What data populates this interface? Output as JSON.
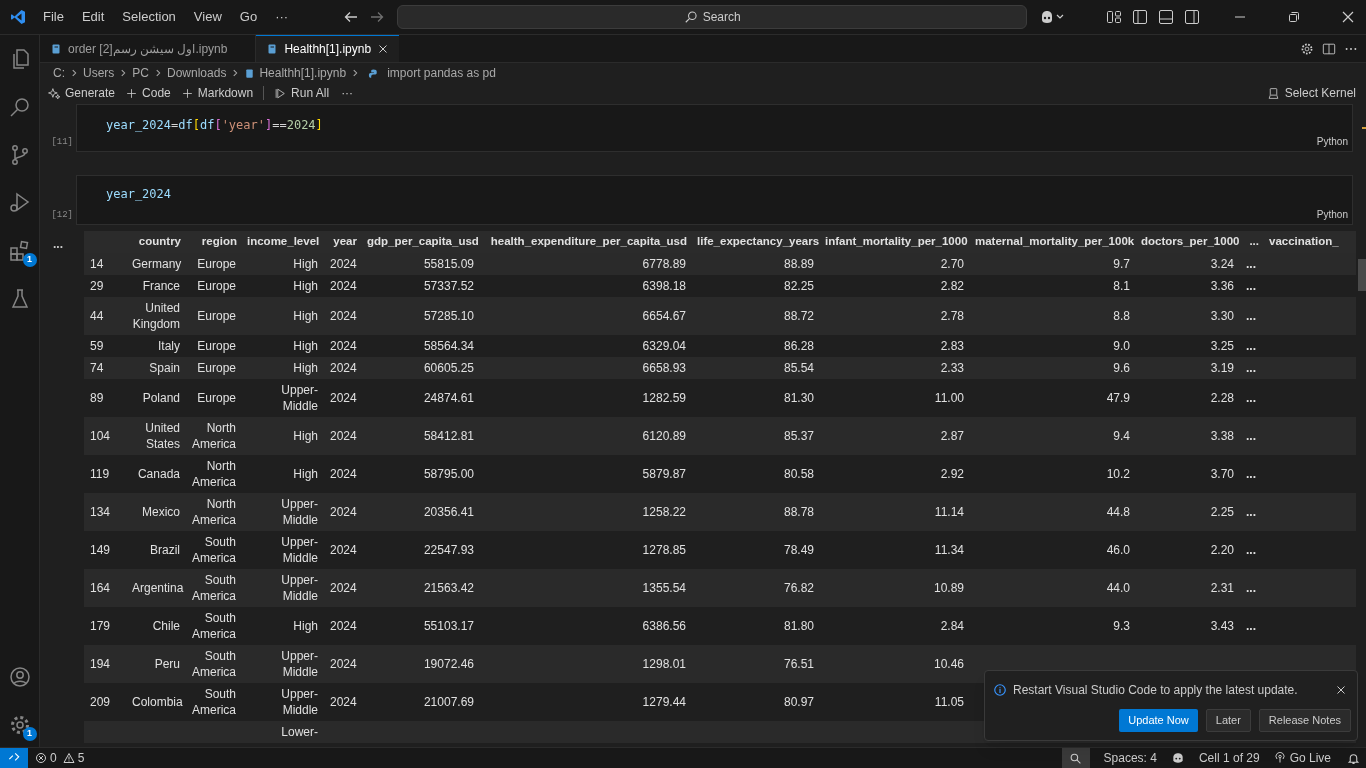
{
  "menu": [
    "File",
    "Edit",
    "Selection",
    "View",
    "Go",
    "···"
  ],
  "search": {
    "placeholder": "Search"
  },
  "activity_bar": [
    {
      "kind": "explorer"
    },
    {
      "kind": "search"
    },
    {
      "kind": "source-control"
    },
    {
      "kind": "run-debug"
    },
    {
      "kind": "extensions",
      "badge": "1"
    },
    {
      "kind": "testing"
    }
  ],
  "activity_bar_bottom": [
    {
      "kind": "accounts"
    },
    {
      "kind": "manage",
      "badge": "1"
    }
  ],
  "tabs": [
    {
      "label": "order [2]اول سيشن رسم.ipynb",
      "selected": false
    },
    {
      "label": "Healthh[1].ipynb",
      "selected": true
    }
  ],
  "breadcrumbs": [
    "C:",
    "Users",
    "PC",
    "Downloads",
    "Healthh[1].ipynb",
    "import pandas as pd"
  ],
  "toolbar": [
    {
      "kind": "generate",
      "label": "Generate"
    },
    {
      "kind": "add",
      "label": "Code"
    },
    {
      "kind": "add",
      "label": "Markdown"
    },
    {
      "kind": "run",
      "label": "Run All"
    },
    {
      "kind": "more",
      "label": "···"
    }
  ],
  "kernel": "Select Kernel",
  "cells": [
    {
      "execution_count": "[11]",
      "language": "Python",
      "code": [
        {
          "text": "year_2024",
          "kind": "variable"
        },
        {
          "text": "=",
          "kind": "operator"
        },
        {
          "text": "df",
          "kind": "variable"
        },
        {
          "text": "[",
          "kind": "bracket1"
        },
        {
          "text": "df",
          "kind": "variable"
        },
        {
          "text": "[",
          "kind": "bracket2"
        },
        {
          "text": "'year'",
          "kind": "string"
        },
        {
          "text": "]",
          "kind": "bracket2"
        },
        {
          "text": "==",
          "kind": "operator"
        },
        {
          "text": "2024",
          "kind": "number"
        },
        {
          "text": "]",
          "kind": "bracket1"
        }
      ]
    },
    {
      "execution_count": "[12]",
      "language": "Python",
      "code": [
        {
          "text": "year_2024",
          "kind": "variable"
        }
      ]
    }
  ],
  "output": {
    "more": "...",
    "table": {
      "columns": [
        "country",
        "region",
        "income_level",
        "year",
        "gdp_per_capita_usd",
        "health_expenditure_per_capita_usd",
        "life_expectancy_years",
        "infant_mortality_per_1000",
        "maternal_mortality_per_100k",
        "doctors_per_1000",
        "...",
        "vaccination_"
      ],
      "rows": [
        {
          "index": "14",
          "country": "Germany",
          "region": "Europe",
          "income_level": "High",
          "year": "2024",
          "gdp": "55815.09",
          "health": "6778.89",
          "life": "88.89",
          "infant": "2.70",
          "maternal": "9.7",
          "doctors": "3.24",
          "more": "..."
        },
        {
          "index": "29",
          "country": "France",
          "region": "Europe",
          "income_level": "High",
          "year": "2024",
          "gdp": "57337.52",
          "health": "6398.18",
          "life": "82.25",
          "infant": "2.82",
          "maternal": "8.1",
          "doctors": "3.36",
          "more": "..."
        },
        {
          "index": "44",
          "country": "United Kingdom",
          "region": "Europe",
          "income_level": "High",
          "year": "2024",
          "gdp": "57285.10",
          "health": "6654.67",
          "life": "88.72",
          "infant": "2.78",
          "maternal": "8.8",
          "doctors": "3.30",
          "more": "..."
        },
        {
          "index": "59",
          "country": "Italy",
          "region": "Europe",
          "income_level": "High",
          "year": "2024",
          "gdp": "58564.34",
          "health": "6329.04",
          "life": "86.28",
          "infant": "2.83",
          "maternal": "9.0",
          "doctors": "3.25",
          "more": "..."
        },
        {
          "index": "74",
          "country": "Spain",
          "region": "Europe",
          "income_level": "High",
          "year": "2024",
          "gdp": "60605.25",
          "health": "6658.93",
          "life": "85.54",
          "infant": "2.33",
          "maternal": "9.6",
          "doctors": "3.19",
          "more": "..."
        },
        {
          "index": "89",
          "country": "Poland",
          "region": "Europe",
          "income_level": "Upper-Middle",
          "year": "2024",
          "gdp": "24874.61",
          "health": "1282.59",
          "life": "81.30",
          "infant": "11.00",
          "maternal": "47.9",
          "doctors": "2.28",
          "more": "..."
        },
        {
          "index": "104",
          "country": "United States",
          "region": "North America",
          "income_level": "High",
          "year": "2024",
          "gdp": "58412.81",
          "health": "6120.89",
          "life": "85.37",
          "infant": "2.87",
          "maternal": "9.4",
          "doctors": "3.38",
          "more": "..."
        },
        {
          "index": "119",
          "country": "Canada",
          "region": "North America",
          "income_level": "High",
          "year": "2024",
          "gdp": "58795.00",
          "health": "5879.87",
          "life": "80.58",
          "infant": "2.92",
          "maternal": "10.2",
          "doctors": "3.70",
          "more": "..."
        },
        {
          "index": "134",
          "country": "Mexico",
          "region": "North America",
          "income_level": "Upper-Middle",
          "year": "2024",
          "gdp": "20356.41",
          "health": "1258.22",
          "life": "88.78",
          "infant": "11.14",
          "maternal": "44.8",
          "doctors": "2.25",
          "more": "..."
        },
        {
          "index": "149",
          "country": "Brazil",
          "region": "South America",
          "income_level": "Upper-Middle",
          "year": "2024",
          "gdp": "22547.93",
          "health": "1278.85",
          "life": "78.49",
          "infant": "11.34",
          "maternal": "46.0",
          "doctors": "2.20",
          "more": "..."
        },
        {
          "index": "164",
          "country": "Argentina",
          "region": "South America",
          "income_level": "Upper-Middle",
          "year": "2024",
          "gdp": "21563.42",
          "health": "1355.54",
          "life": "76.82",
          "infant": "10.89",
          "maternal": "44.0",
          "doctors": "2.31",
          "more": "..."
        },
        {
          "index": "179",
          "country": "Chile",
          "region": "South America",
          "income_level": "High",
          "year": "2024",
          "gdp": "55103.17",
          "health": "6386.56",
          "life": "81.80",
          "infant": "2.84",
          "maternal": "9.3",
          "doctors": "3.43",
          "more": "..."
        },
        {
          "index": "194",
          "country": "Peru",
          "region": "South America",
          "income_level": "Upper-Middle",
          "year": "2024",
          "gdp": "19072.46",
          "health": "1298.01",
          "life": "76.51",
          "infant": "10.46"
        },
        {
          "index": "209",
          "country": "Colombia",
          "region": "South America",
          "income_level": "Upper-Middle",
          "year": "2024",
          "gdp": "21007.69",
          "health": "1279.44",
          "life": "80.97",
          "infant": "11.05"
        },
        {
          "income_level": "Lower-"
        }
      ]
    }
  },
  "notification": {
    "message": "Restart Visual Studio Code to apply the latest update.",
    "buttons": [
      {
        "label": "Update Now",
        "primary": true
      },
      {
        "label": "Later",
        "primary": false
      },
      {
        "label": "Release Notes",
        "primary": false
      }
    ]
  },
  "status_bar": {
    "errors": "0",
    "warnings": "5",
    "items": [
      {
        "kind": "zoom"
      },
      {
        "kind": "text",
        "label": "Spaces: 4"
      },
      {
        "kind": "copilot"
      },
      {
        "kind": "text",
        "label": "Cell 1 of 29"
      },
      {
        "kind": "golive",
        "label": "Go Live"
      },
      {
        "kind": "bell"
      }
    ]
  }
}
